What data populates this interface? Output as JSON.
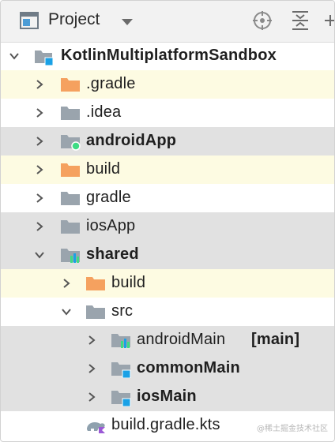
{
  "toolbar": {
    "title": "Project",
    "icons": [
      "project-window-icon",
      "chevron-down-icon",
      "locate-target-icon",
      "collapse-all-icon",
      "settings-icon"
    ]
  },
  "tree": {
    "root": "KotlinMultiplatformSandbox",
    "items": {
      "gradle_hidden": ".gradle",
      "idea": ".idea",
      "androidApp": "androidApp",
      "build": "build",
      "gradle": "gradle",
      "iosApp": "iosApp",
      "shared": "shared",
      "shared_build": "build",
      "src": "src",
      "androidMain": "androidMain",
      "androidMain_tag": "[main]",
      "commonMain": "commonMain",
      "iosMain": "iosMain",
      "build_gradle_kts": "build.gradle.kts"
    }
  },
  "watermark": "@稀土掘金技术社区",
  "colors": {
    "excluded_folder": "#f5a15f",
    "plain_folder": "#9aa4ad",
    "source_badge": "#1aa1e6",
    "android_badge": "#3ddc84",
    "selection_gray": "#e1e1e1",
    "excluded_row": "#fdfbe2"
  }
}
